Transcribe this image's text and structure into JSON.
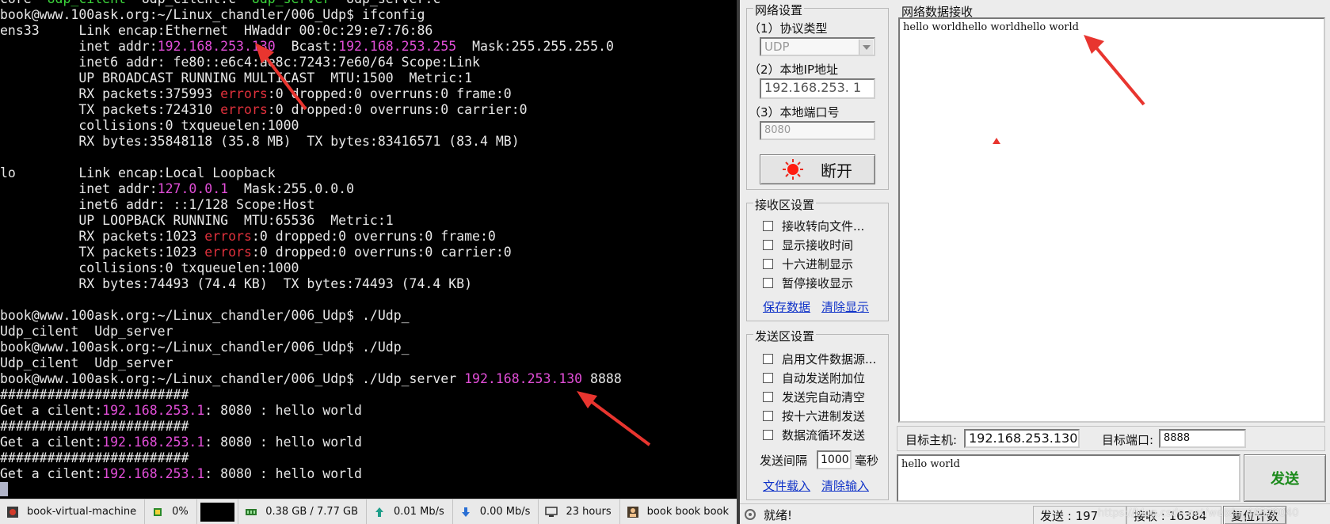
{
  "terminal": {
    "lines": [
      [
        {
          "t": "core  ",
          "c": ""
        },
        {
          "t": "Udp_cilent",
          "c": "grn"
        },
        {
          "t": "  ",
          "c": ""
        },
        {
          "t": "Udp_cilent.c",
          "c": ""
        },
        {
          "t": "  ",
          "c": ""
        },
        {
          "t": "Udp_server",
          "c": "grn"
        },
        {
          "t": "  Udp_server.c",
          "c": ""
        }
      ],
      [
        {
          "t": "book@www.100ask.org:~/Linux_chandler/006_Udp$ ifconfig",
          "c": ""
        }
      ],
      [
        {
          "t": "ens33     Link encap:Ethernet  HWaddr 00:0c:29:e7:76:86",
          "c": ""
        }
      ],
      [
        {
          "t": "          inet addr:",
          "c": ""
        },
        {
          "t": "192.168.253.130",
          "c": "mag"
        },
        {
          "t": "  Bcast:",
          "c": ""
        },
        {
          "t": "192.168.253.255",
          "c": "mag"
        },
        {
          "t": "  Mask:255.255.255.0",
          "c": ""
        }
      ],
      [
        {
          "t": "          inet6 addr: fe80::e6c4:ae8c:7243:7e60/64 Scope:Link",
          "c": ""
        }
      ],
      [
        {
          "t": "          UP BROADCAST RUNNING MULTICAST  MTU:1500  Metric:1",
          "c": ""
        }
      ],
      [
        {
          "t": "          RX packets:375993 ",
          "c": ""
        },
        {
          "t": "errors",
          "c": "red"
        },
        {
          "t": ":0 dropped:0 overruns:0 frame:0",
          "c": ""
        }
      ],
      [
        {
          "t": "          TX packets:724310 ",
          "c": ""
        },
        {
          "t": "errors",
          "c": "red"
        },
        {
          "t": ":0 dropped:0 overruns:0 carrier:0",
          "c": ""
        }
      ],
      [
        {
          "t": "          collisions:0 txqueuelen:1000",
          "c": ""
        }
      ],
      [
        {
          "t": "          RX bytes:35848118 (35.8 MB)  TX bytes:83416571 (83.4 MB)",
          "c": ""
        }
      ],
      [
        {
          "t": "",
          "c": ""
        }
      ],
      [
        {
          "t": "lo        Link encap:Local Loopback",
          "c": ""
        }
      ],
      [
        {
          "t": "          inet addr:",
          "c": ""
        },
        {
          "t": "127.0.0.1",
          "c": "mag"
        },
        {
          "t": "  Mask:255.0.0.0",
          "c": ""
        }
      ],
      [
        {
          "t": "          inet6 addr: ::1/128 Scope:Host",
          "c": ""
        }
      ],
      [
        {
          "t": "          UP LOOPBACK RUNNING  MTU:65536  Metric:1",
          "c": ""
        }
      ],
      [
        {
          "t": "          RX packets:1023 ",
          "c": ""
        },
        {
          "t": "errors",
          "c": "red"
        },
        {
          "t": ":0 dropped:0 overruns:0 frame:0",
          "c": ""
        }
      ],
      [
        {
          "t": "          TX packets:1023 ",
          "c": ""
        },
        {
          "t": "errors",
          "c": "red"
        },
        {
          "t": ":0 dropped:0 overruns:0 carrier:0",
          "c": ""
        }
      ],
      [
        {
          "t": "          collisions:0 txqueuelen:1000",
          "c": ""
        }
      ],
      [
        {
          "t": "          RX bytes:74493 (74.4 KB)  TX bytes:74493 (74.4 KB)",
          "c": ""
        }
      ],
      [
        {
          "t": "",
          "c": ""
        }
      ],
      [
        {
          "t": "book@www.100ask.org:~/Linux_chandler/006_Udp$ ./Udp_",
          "c": ""
        }
      ],
      [
        {
          "t": "Udp_cilent  Udp_server",
          "c": ""
        }
      ],
      [
        {
          "t": "book@www.100ask.org:~/Linux_chandler/006_Udp$ ./Udp_",
          "c": ""
        }
      ],
      [
        {
          "t": "Udp_cilent  Udp_server",
          "c": ""
        }
      ],
      [
        {
          "t": "book@www.100ask.org:~/Linux_chandler/006_Udp$ ./Udp_server ",
          "c": ""
        },
        {
          "t": "192.168.253.130",
          "c": "mag"
        },
        {
          "t": " 8888",
          "c": ""
        }
      ],
      [
        {
          "t": "########################",
          "c": ""
        }
      ],
      [
        {
          "t": "Get a cilent:",
          "c": ""
        },
        {
          "t": "192.168.253.1",
          "c": "mag"
        },
        {
          "t": ": 8080 : hello world",
          "c": ""
        }
      ],
      [
        {
          "t": "########################",
          "c": ""
        }
      ],
      [
        {
          "t": "Get a cilent:",
          "c": ""
        },
        {
          "t": "192.168.253.1",
          "c": "mag"
        },
        {
          "t": ": 8080 : hello world",
          "c": ""
        }
      ],
      [
        {
          "t": "########################",
          "c": ""
        }
      ],
      [
        {
          "t": "Get a cilent:",
          "c": ""
        },
        {
          "t": "192.168.253.1",
          "c": "mag"
        },
        {
          "t": ": 8080 : hello world",
          "c": ""
        }
      ]
    ]
  },
  "taskbar": {
    "host": "book-virtual-machine",
    "cpu": "0%",
    "memory": "0.38 GB / 7.77 GB",
    "upload": "0.01 Mb/s",
    "download": "0.00 Mb/s",
    "uptime": "23 hours",
    "users": "book  book  book"
  },
  "app": {
    "net_settings": {
      "title": "网络设置",
      "protocol_label": "（1）协议类型",
      "protocol_value": "UDP",
      "local_ip_label": "（2）本地IP地址",
      "local_ip_value": "192.168.253. 1",
      "local_port_label": "（3）本地端口号",
      "local_port_value": "8080",
      "disconnect_label": "断开"
    },
    "recv_area": {
      "title": "网络数据接收",
      "content": "hello worldhello worldhello world"
    },
    "recv_settings": {
      "title": "接收区设置",
      "options": [
        "接收转向文件...",
        "显示接收时间",
        "十六进制显示",
        "暂停接收显示"
      ],
      "save_link": "保存数据",
      "clear_link": "清除显示"
    },
    "send_settings": {
      "title": "发送区设置",
      "options": [
        "启用文件数据源...",
        "自动发送附加位",
        "发送完自动清空",
        "按十六进制发送",
        "数据流循环发送"
      ],
      "interval_label": "发送间隔",
      "interval_value": "1000",
      "interval_unit": "毫秒",
      "load_link": "文件载入",
      "clear_input_link": "清除输入"
    },
    "target": {
      "host_label": "目标主机:",
      "host_value": "192.168.253.130",
      "port_label": "目标端口:",
      "port_value": "8888"
    },
    "send_box": {
      "content": "hello world",
      "send_label": "发送"
    },
    "status": {
      "ready": "就绪!",
      "send_label": "发送 : 197",
      "recv_label": "接收 : 16384",
      "reset_label": "复位计数",
      "watermark": "https://blog.csdn.net/weixin_44570040"
    }
  }
}
